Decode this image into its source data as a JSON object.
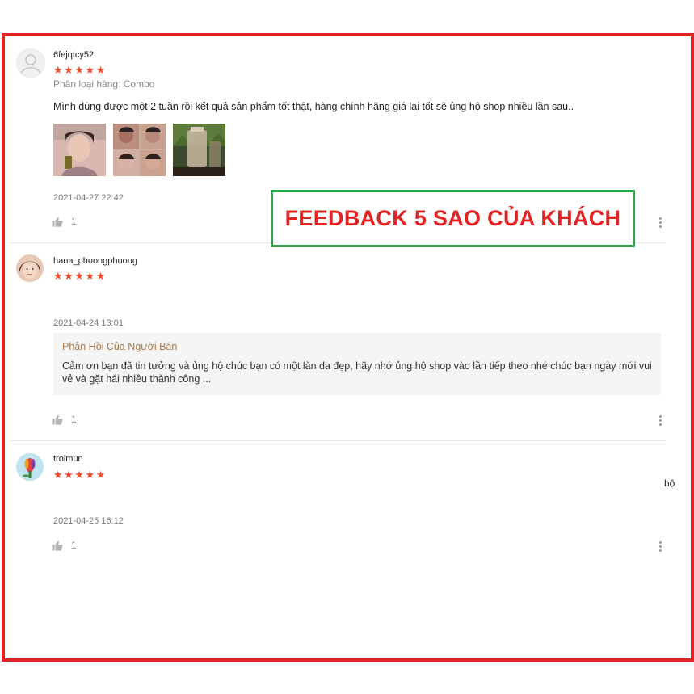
{
  "badge": {
    "text": "FEEDBACK 5 SAO CỦA KHÁCH"
  },
  "reviews": [
    {
      "username": "6fejqtcy52",
      "stars": "★★★★★",
      "variation": "Phân loại hàng: Combo",
      "comment": "Mình dùng được một 2 tuần rồi kết quả sản phẩm tốt thật, hàng chính hãng giá lại tốt sẽ ủng hộ shop nhiều lần sau..",
      "photos": [
        "product-photo-1",
        "product-photo-2",
        "product-photo-3"
      ],
      "time": "2021-04-27 22:42",
      "likes": "1"
    },
    {
      "username": "hana_phuongphuong",
      "stars": "★★★★★",
      "time": "2021-04-24 13:01",
      "reply": {
        "title": "Phản Hồi Của Người Bán",
        "text": "Cảm ơn bạn đã tin tưởng và ủng hộ chúc bạn có một làn da đẹp, hãy nhớ ủng hộ shop vào lần tiếp theo nhé chúc bạn ngày mới vui vẻ và gặt hái nhiều thành công ..."
      },
      "likes": "1"
    },
    {
      "username": "troimun",
      "stars": "★★★★★",
      "time": "2021-04-25 16:12",
      "likes": "1"
    }
  ],
  "stray_text": "hộ",
  "colors": {
    "frame": "#e02424",
    "badge_border": "#2ea84a",
    "stars": "#ee4d2d",
    "reply_title": "#a9794b"
  },
  "icons": [
    "default-avatar-icon",
    "thumbs-up-icon",
    "more-options-icon"
  ]
}
